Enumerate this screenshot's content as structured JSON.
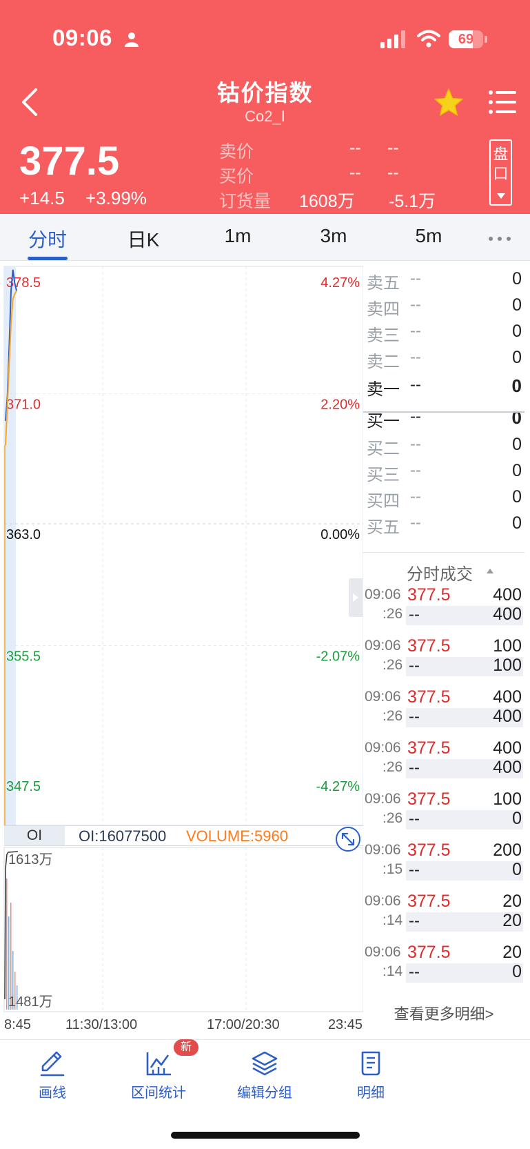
{
  "status_bar": {
    "time": "09:06",
    "battery": "69",
    "battery_level_pct": 69
  },
  "header": {
    "title": "钴价指数",
    "subtitle": "Co2_I",
    "price": "377.5",
    "change_abs": "+14.5",
    "change_pct": "+3.99%",
    "quote_rows": [
      {
        "label": "卖价",
        "v1": "--",
        "v2": "--"
      },
      {
        "label": "买价",
        "v1": "--",
        "v2": "--"
      },
      {
        "label": "订货量",
        "v1": "1608万",
        "v2": "-5.1万"
      }
    ],
    "pankou_label": "盘口"
  },
  "tabs": [
    {
      "label": "分时",
      "active": true
    },
    {
      "label": "日K",
      "active": false
    },
    {
      "label": "1m",
      "active": false
    },
    {
      "label": "3m",
      "active": false
    },
    {
      "label": "5m",
      "active": false
    }
  ],
  "chart": {
    "y_labels": [
      {
        "price": "378.5",
        "pct": "4.27%",
        "color": "#e12b2b"
      },
      {
        "price": "371.0",
        "pct": "2.20%",
        "color": "#e12b2b"
      },
      {
        "price": "363.0",
        "pct": "0.00%",
        "color": "#111111"
      },
      {
        "price": "355.5",
        "pct": "-2.07%",
        "color": "#1a9b3c"
      },
      {
        "price": "347.5",
        "pct": "-4.27%",
        "color": "#1a9b3c"
      }
    ],
    "oi_tag": "OI",
    "oi_text": "OI:16077500",
    "volume_text": "VOLUME:5960",
    "vol_top_label": "1613万",
    "vol_bottom_label": "1481万",
    "x_labels": [
      "8:45",
      "11:30/13:00",
      "17:00/20:30",
      "23:45"
    ]
  },
  "chart_data": {
    "type": "line",
    "title": "",
    "series": [
      {
        "values": [
          369.5,
          371.0,
          374.0,
          377.5,
          378.8,
          378.0,
          377.5
        ]
      },
      {
        "values": [
          368.0,
          370.5,
          373.0,
          375.5,
          377.0,
          377.3,
          377.5
        ]
      }
    ],
    "ylim": [
      347.5,
      378.5
    ],
    "y_ticks": [
      378.5,
      371.0,
      363.0,
      355.5,
      347.5
    ],
    "x_ticks": [
      "8:45",
      "11:30/13:00",
      "17:00/20:30",
      "23:45"
    ],
    "colors": {
      "price": "#2c5ec8",
      "average": "#f5a623"
    }
  },
  "order_book": {
    "asks": [
      {
        "label": "卖五",
        "price": "--",
        "vol": "0"
      },
      {
        "label": "卖四",
        "price": "--",
        "vol": "0"
      },
      {
        "label": "卖三",
        "price": "--",
        "vol": "0"
      },
      {
        "label": "卖二",
        "price": "--",
        "vol": "0"
      },
      {
        "label": "卖一",
        "price": "--",
        "vol": "0"
      }
    ],
    "bids": [
      {
        "label": "买一",
        "price": "--",
        "vol": "0"
      },
      {
        "label": "买二",
        "price": "--",
        "vol": "0"
      },
      {
        "label": "买三",
        "price": "--",
        "vol": "0"
      },
      {
        "label": "买四",
        "price": "--",
        "vol": "0"
      },
      {
        "label": "买五",
        "price": "--",
        "vol": "0"
      }
    ]
  },
  "trades": {
    "title": "分时成交",
    "items": [
      {
        "time": "09:06",
        "sec": ":26",
        "price": "377.5",
        "vol1": "400",
        "price2": "--",
        "vol2": "400"
      },
      {
        "time": "09:06",
        "sec": ":26",
        "price": "377.5",
        "vol1": "100",
        "price2": "--",
        "vol2": "100"
      },
      {
        "time": "09:06",
        "sec": ":26",
        "price": "377.5",
        "vol1": "400",
        "price2": "--",
        "vol2": "400"
      },
      {
        "time": "09:06",
        "sec": ":26",
        "price": "377.5",
        "vol1": "400",
        "price2": "--",
        "vol2": "400"
      },
      {
        "time": "09:06",
        "sec": ":26",
        "price": "377.5",
        "vol1": "100",
        "price2": "--",
        "vol2": "0"
      },
      {
        "time": "09:06",
        "sec": ":15",
        "price": "377.5",
        "vol1": "200",
        "price2": "--",
        "vol2": "0"
      },
      {
        "time": "09:06",
        "sec": ":14",
        "price": "377.5",
        "vol1": "20",
        "price2": "--",
        "vol2": "20"
      },
      {
        "time": "09:06",
        "sec": ":14",
        "price": "377.5",
        "vol1": "20",
        "price2": "--",
        "vol2": "0"
      }
    ],
    "more_label": "查看更多明细>"
  },
  "toolbar": {
    "items": [
      {
        "label": "画线",
        "icon": "pencil-icon"
      },
      {
        "label": "区间统计",
        "icon": "stats-chart-icon"
      },
      {
        "label": "编辑分组",
        "icon": "layers-icon"
      },
      {
        "label": "明细",
        "icon": "document-icon"
      }
    ],
    "badge": "新"
  },
  "colors": {
    "header_bg": "#f75d5e",
    "accent": "#2c5ec8",
    "up": "#e12b2b",
    "down": "#1a9b3c",
    "volume": "#ff7a1a"
  }
}
